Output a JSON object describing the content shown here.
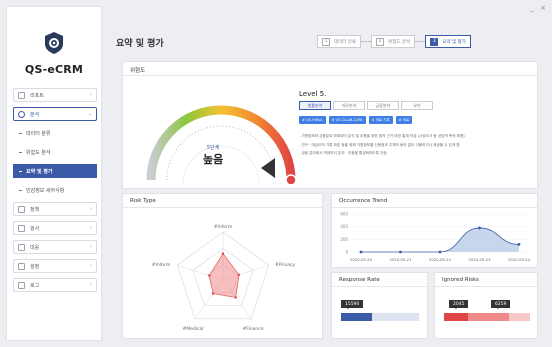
{
  "window": {
    "minimize": "_",
    "close": "×"
  },
  "app": {
    "name": "QS-eCRM"
  },
  "sidebar": {
    "items": [
      {
        "label": "리포트"
      },
      {
        "label": "분석",
        "open": true
      },
      {
        "label": "정책"
      },
      {
        "label": "검사"
      },
      {
        "label": "대응"
      },
      {
        "label": "설정"
      },
      {
        "label": "로그"
      }
    ],
    "sub": [
      "데이터 분류",
      "위험도 분석",
      "요약 및 평가",
      "민감정보 세부사항"
    ]
  },
  "page": {
    "title": "요약 및 평가"
  },
  "steps": [
    {
      "num": "1",
      "label": "데이터 분류"
    },
    {
      "num": "2",
      "label": "위험도 분석"
    },
    {
      "num": "3",
      "label": "요약 및 평가"
    }
  ],
  "risk": {
    "title": "위험도",
    "level_title": "Level 5.",
    "gauge_level_label": "5단계",
    "gauge_word": "높음",
    "gauge_fraction": 1.0,
    "tabs": [
      "법률분야",
      "의료분야",
      "금융분야",
      "요약"
    ],
    "tags": [
      "# US-HIPAA",
      "# US-CA-AB-1298",
      "# 의료 기록",
      "# 의료"
    ],
    "notes": [
      "- 가명정보와 금융분야 마데이터 분석 및 이용을 위한 법적 근거 마련 통계 작성 (시장조사 등 상업적 목적 포함)",
      "- 연구 · 마금이직 기록 보존 등을 위해 가명정보를 신용정보 주체의 동의 없이 이용하거나 제공할 수 있게 함",
      "- 금융 분야에서 빅데이터 분석 · 이용을 활성화하도록 규정"
    ]
  },
  "risk_type": {
    "title": "Risk Type",
    "chart_data": {
      "type": "radar",
      "axes": [
        "#Inform",
        "#Privacy",
        "#Finance",
        "#Medical",
        "#Inform"
      ],
      "values": [
        0.55,
        0.35,
        0.45,
        0.35,
        0.3
      ]
    }
  },
  "trend": {
    "title": "Occurrence Trend",
    "chart_data": {
      "type": "area",
      "x": [
        "2020-09-20",
        "2020-09-21",
        "2020-09-22",
        "2020-09-23",
        "2020-09-24"
      ],
      "values": [
        0,
        0,
        0,
        380,
        120
      ],
      "yticks": [
        "600",
        "400",
        "200",
        "0"
      ],
      "ylim": [
        0,
        600
      ]
    }
  },
  "response": {
    "title": "Response Rate",
    "value": "15590",
    "fraction": 0.4
  },
  "ignored": {
    "title": "Ignored Risks",
    "values": [
      "2045",
      "6259"
    ],
    "fraction_a": 0.28,
    "fraction_b": 0.75
  },
  "colors": {
    "accent": "#3b5ba9",
    "tag": "#3e7ee6",
    "danger": "#e04545",
    "chart_fill": "#b9cbe9",
    "radar": "#f08a8a"
  }
}
